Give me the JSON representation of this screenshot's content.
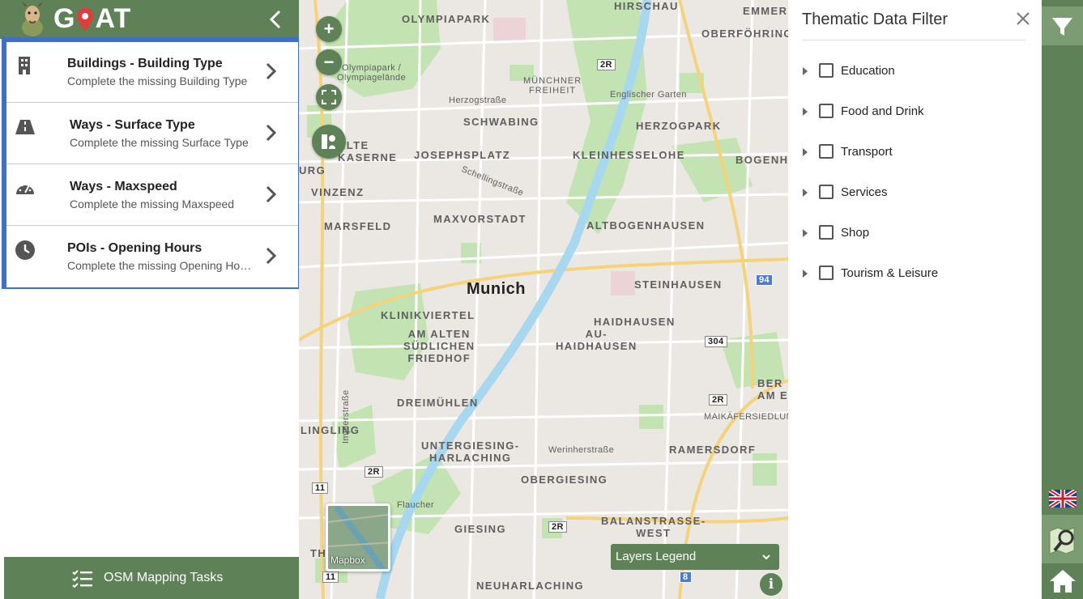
{
  "app": {
    "logo_text_left": "G",
    "logo_text_right": "AT"
  },
  "tasks": [
    {
      "title": "Buildings - Building Type",
      "subtitle": "Complete the missing Building Type",
      "icon": "building-icon"
    },
    {
      "title": "Ways - Surface Type",
      "subtitle": "Complete the missing Surface Type",
      "icon": "road-icon"
    },
    {
      "title": "Ways - Maxspeed",
      "subtitle": "Complete the missing Maxspeed",
      "icon": "speedometer-icon"
    },
    {
      "title": "POIs - Opening Hours",
      "subtitle": "Complete the missing Opening Hours",
      "icon": "clock-icon"
    }
  ],
  "bottom_bar": {
    "label": "OSM Mapping Tasks"
  },
  "map": {
    "city": "Munich",
    "labels": [
      "OLYMPIAPARK",
      "Olympiapark /\nOlympiagelände",
      "MÜNCHNER\nFREIHEIT",
      "Englischer Garten",
      "SCHWABING",
      "HERZOGPARK",
      "Herzogstraße",
      "JOSEPHSPLATZ",
      "KLEINHESSELOHE",
      "ALTE\nKASERNE",
      "Schellingstraße",
      "VINZENZ",
      "MARSFELD",
      "MAXVORSTADT",
      "ALTBOGENHAUSEN",
      "STEINHAUSEN",
      "KLINIKVIERTEL",
      "AM ALTEN\nSÜDLICHEN\nFRIEDHOF",
      "HAIDHAUSEN",
      "AU-\nHAIDHAUSEN",
      "DREIMÜHLEN",
      "MAIKÄFERSIEDLUNG",
      "LINGLING",
      "UNTERGIESING-\nHARLACHING",
      "Werinherstraße",
      "RAMERSDORF",
      "OBERGIESING",
      "Flaucher",
      "GIESING",
      "BALANSTRASSE-\nWEST",
      "NEUHARLACHING",
      "HIRSCHAU",
      "EMMERAM",
      "OBERFÖHRING",
      "BOGENHA",
      "BER\nAM ES",
      "Implerstraße",
      "URG",
      "TH"
    ],
    "road_badges": [
      "2R",
      "2R",
      "2R",
      "2R",
      "94",
      "304",
      "11",
      "11",
      "8"
    ],
    "zoom_in": "+",
    "zoom_out": "−",
    "basemap_label": "Mapbox",
    "layers_legend": "Layers Legend",
    "info": "i"
  },
  "filter_panel": {
    "title": "Thematic Data Filter",
    "items": [
      "Education",
      "Food and Drink",
      "Transport",
      "Services",
      "Shop",
      "Tourism & Leisure"
    ]
  },
  "colors": {
    "primary_green": "#5e8157",
    "light_green": "#7c9c74",
    "task_border": "#3f6fc6"
  }
}
